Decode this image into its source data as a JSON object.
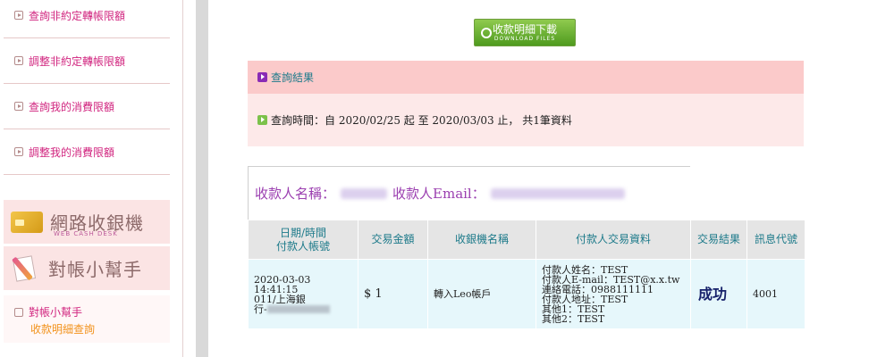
{
  "sidebar": {
    "menu_items": [
      {
        "label": "查詢非約定轉帳限額"
      },
      {
        "label": "調整非約定轉帳限額"
      },
      {
        "label": "查詢我的消費限額"
      },
      {
        "label": "調整我的消費限額"
      }
    ],
    "banner_cash": {
      "title": "網路收銀機",
      "subtitle": "WEB CASH DESK"
    },
    "banner_helper": {
      "title": "對帳小幫手"
    },
    "helper_item": {
      "label": "對帳小幫手",
      "sublabel": "收款明細查詢"
    }
  },
  "download_button": {
    "label": "收款明細下載",
    "sublabel": "DOWNLOAD FILES"
  },
  "result": {
    "title": "查詢結果",
    "query_text": "查詢時間：自 2020/02/25 起 至 2020/03/03 止， 共1筆資料"
  },
  "payee": {
    "name_label": "收款人名稱：",
    "email_label": "收款人Email："
  },
  "table": {
    "headers": {
      "datetime": "日期/時間",
      "payer_account": "付款人帳號",
      "amount": "交易金額",
      "terminal": "收銀機名稱",
      "payer_info": "付款人交易資料",
      "result": "交易結果",
      "code": "訊息代號"
    },
    "rows": [
      {
        "datetime": "2020-03-03 14:41:15",
        "account_prefix": "011/上海銀",
        "account_line2": "行-",
        "amount": "$ 1",
        "terminal": "轉入Leo帳戶",
        "payer_info": [
          "付款人姓名：TEST",
          "付款人E-mail：TEST@x.x.tw",
          "連絡電話：0988111111",
          "付款人地址：TEST",
          "其他1：TEST",
          "其他2：TEST"
        ],
        "status": "成功",
        "code": "4001"
      }
    ]
  }
}
